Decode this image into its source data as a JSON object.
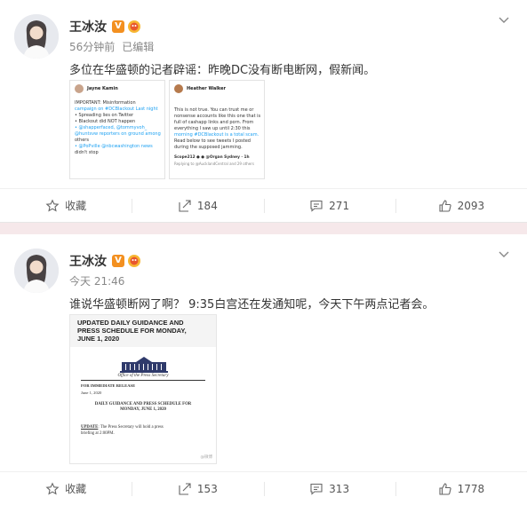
{
  "posts": [
    {
      "username": "王冰汝",
      "verified_label": "V",
      "time": "56分钟前",
      "edited": "已编辑",
      "text": "多位在华盛顿的记者辟谣：昨晚DC没有断电断网，假新闻。",
      "images": [
        {
          "author": "Jayne Kamin",
          "lines": [
            "IMPORTANT: Misinformation",
            "campaign on #DCBlackout Last night",
            "• Spreading lies on Twitter",
            "• Blackout did NOT happen",
            "• @shapperfaced, @tommyvoh_",
            "@huntsvw reporters on ground among",
            "others",
            "• @PoPville @nbcwashington news",
            "didn't stop"
          ]
        },
        {
          "author": "Heather Walker",
          "lines": [
            "This is not true. You can trust me or",
            "nonsense accounts like this one that is",
            "full of cashapp links and porn. From",
            "everything I saw up until 2:30 this",
            "morning #DCBlackout is a total scam.",
            "Read below to see tweets I posted",
            "during the supposed jamming."
          ],
          "footer": "Scope212 ● ● @Organ Sydney · 1h",
          "footer2": "Replying to @AucklandCentral and 29 others"
        }
      ],
      "actions": {
        "fav": "收藏",
        "repost": "184",
        "comment": "271",
        "like": "2093"
      }
    },
    {
      "username": "王冰汝",
      "verified_label": "V",
      "time": "今天 21:46",
      "text": "谁说华盛顿断网了啊？ 9:35白宫还在发通知呢，今天下午两点记者会。",
      "doc": {
        "header": [
          "UPDATED DAILY GUIDANCE AND",
          "PRESS SCHEDULE FOR MONDAY,",
          "JUNE 1, 2020"
        ],
        "office": "Office of the Press Secretary",
        "release": "FOR IMMEDIATE RELEASE",
        "date": "June 1, 2020",
        "title": [
          "DAILY GUIDANCE AND PRESS SCHEDULE FOR",
          "MONDAY, JUNE 1, 2020"
        ],
        "update_label": "UPDATE",
        "update_text": ": The Press Secretary will hold a press",
        "update_text2": "briefing at 2:00PM.",
        "watermark": "@微博"
      },
      "actions": {
        "fav": "收藏",
        "repost": "153",
        "comment": "313",
        "like": "1778"
      }
    }
  ],
  "colors": {
    "accent": "#f39020",
    "link": "#1da1f2",
    "divider": "#f6e8ea"
  },
  "icons": [
    "star-icon",
    "repost-icon",
    "comment-icon",
    "like-icon",
    "chevron-down-icon"
  ]
}
